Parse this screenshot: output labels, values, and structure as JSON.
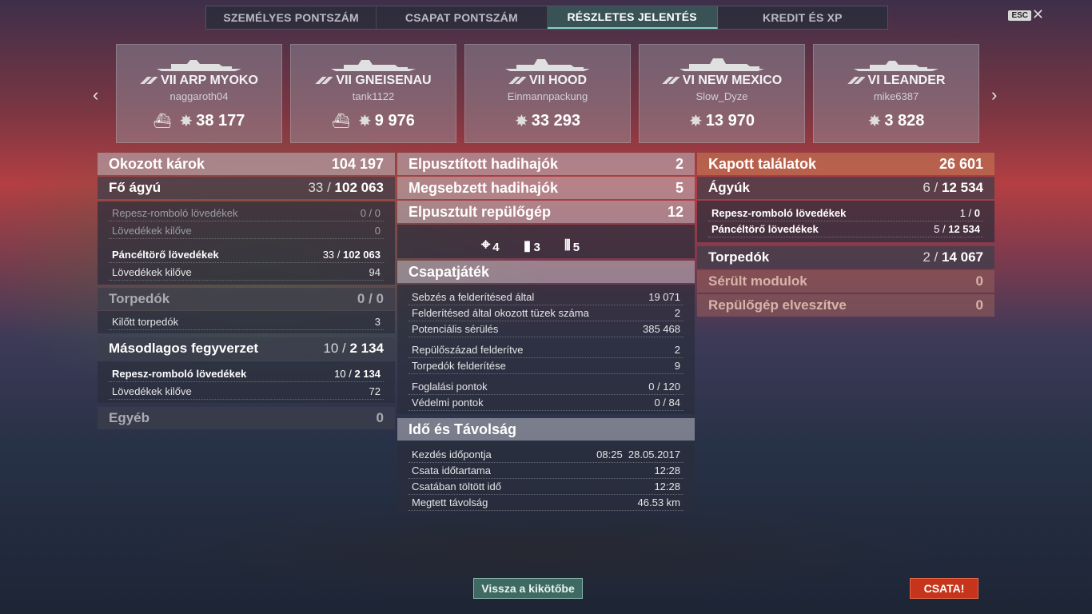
{
  "tabs": [
    {
      "label": "SZEMÉLYES PONTSZÁM"
    },
    {
      "label": "CSAPAT PONTSZÁM"
    },
    {
      "label": "RÉSZLETES JELENTÉS"
    },
    {
      "label": "KREDIT ÉS XP"
    }
  ],
  "esc_label": "ESC",
  "ships": [
    {
      "tier": "VII",
      "name": "ARP MYOKO",
      "title": "VII ARP MYOKO",
      "player": "naggaroth04",
      "damage": "38 177"
    },
    {
      "tier": "VII",
      "name": "GNEISENAU",
      "title": "VII GNEISENAU",
      "player": "tank1122",
      "damage": "9 976"
    },
    {
      "tier": "VII",
      "name": "HOOD",
      "title": "VII HOOD",
      "player": "Einmannpackung",
      "damage": "33 293"
    },
    {
      "tier": "VI",
      "name": "NEW MEXICO",
      "title": "VI NEW MEXICO",
      "player": "Slow_Dyze",
      "damage": "13 970"
    },
    {
      "tier": "VI",
      "name": "LEANDER",
      "title": "VI LEANDER",
      "player": "mike6387",
      "damage": "3 828"
    }
  ],
  "left": {
    "damage_caused": {
      "label": "Okozott károk",
      "value": "104 197"
    },
    "main_battery": {
      "label": "Fő ágyú",
      "hits": "33 /",
      "value": "102 063"
    },
    "he_label": "Repesz-romboló lövedékek",
    "he_value": "0 / 0",
    "he_fired_label": "Lövedékek kilőve",
    "he_fired_value": "0",
    "ap_label": "Páncéltörő lövedékek",
    "ap_hits": "33 /",
    "ap_value": "102 063",
    "ap_fired_label": "Lövedékek kilőve",
    "ap_fired_value": "94",
    "torpedoes": {
      "label": "Torpedók",
      "value": "0 / 0"
    },
    "torp_fired_label": "Kilőtt torpedók",
    "torp_fired_value": "3",
    "secondary": {
      "label": "Másodlagos fegyverzet",
      "hits": "10 /",
      "value": "2 134"
    },
    "sec_he_label": "Repesz-romboló lövedékek",
    "sec_he_hits": "10 /",
    "sec_he_value": "2 134",
    "sec_fired_label": "Lövedékek kilőve",
    "sec_fired_value": "72",
    "other": {
      "label": "Egyéb",
      "value": "0"
    }
  },
  "middle": {
    "destroyed": {
      "label": "Elpusztított hadihajók",
      "value": "2"
    },
    "damaged": {
      "label": "Megsebzett hadihajók",
      "value": "5"
    },
    "planes": {
      "label": "Elpusztult repülőgép",
      "value": "12"
    },
    "icons": [
      {
        "name": "target",
        "value": "4"
      },
      {
        "name": "shell",
        "value": "3"
      },
      {
        "name": "ammo",
        "value": "5"
      }
    ],
    "team_header": "Csapatjáték",
    "team_rows": [
      {
        "label": "Sebzés a felderítésed által",
        "value": "19 071"
      },
      {
        "label": "Felderítésed által okozott tüzek száma",
        "value": "2"
      },
      {
        "label": "Potenciális sérülés",
        "value": "385 468"
      },
      {
        "label": "Repülőszázad felderítve",
        "value": "2"
      },
      {
        "label": "Torpedók felderítése",
        "value": "9"
      },
      {
        "label": "Foglalási pontok",
        "value": "0 / 120"
      },
      {
        "label": "Védelmi pontok",
        "value": "0 / 84"
      }
    ],
    "time_header": "Idő és Távolság",
    "time_rows": [
      {
        "label": "Kezdés időpontja",
        "value": "08:25  28.05.2017"
      },
      {
        "label": "Csata időtartama",
        "value": "12:28"
      },
      {
        "label": "Csatában töltött idő",
        "value": "12:28"
      },
      {
        "label": "Megtett távolság",
        "value": "46.53 km"
      }
    ]
  },
  "right": {
    "hits_received": {
      "label": "Kapott találatok",
      "value": "26 601"
    },
    "guns": {
      "label": "Ágyúk",
      "hits": "6 /",
      "value": "12 534"
    },
    "he_label": "Repesz-romboló lövedékek",
    "he_hits": "1 /",
    "he_value": "0",
    "ap_label": "Páncéltörő lövedékek",
    "ap_hits": "5 /",
    "ap_value": "12 534",
    "torpedoes": {
      "label": "Torpedók",
      "hits": "2 /",
      "value": "14 067"
    },
    "modules": {
      "label": "Sérült modulok",
      "value": "0"
    },
    "planes_lost": {
      "label": "Repülőgép elveszítve",
      "value": "0"
    }
  },
  "buttons": {
    "port": "Vissza a kikötőbe",
    "battle": "CSATA!"
  }
}
